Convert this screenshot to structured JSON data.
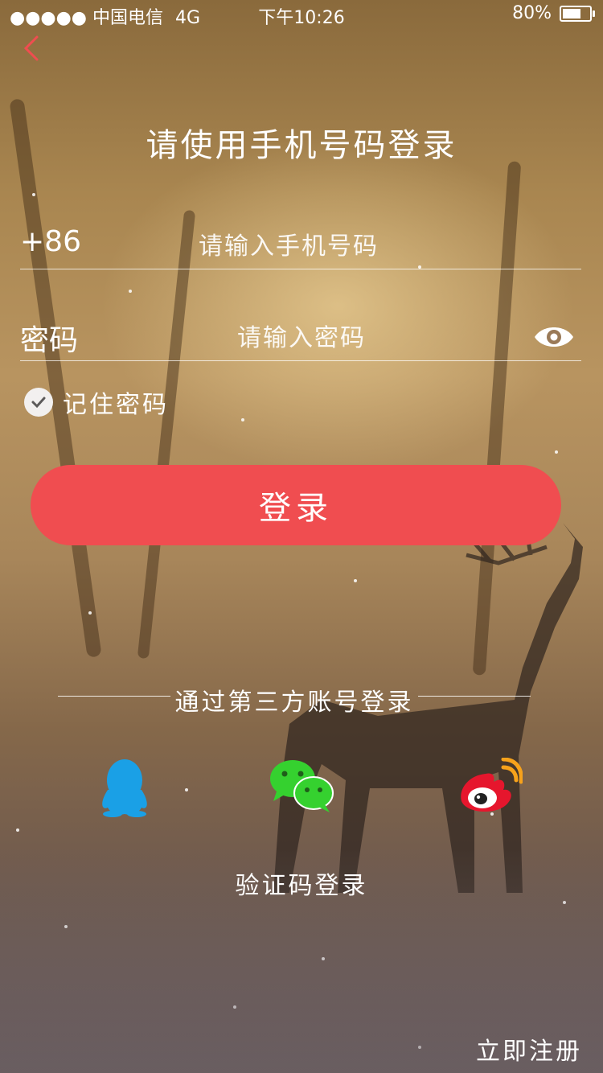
{
  "status_bar": {
    "signal_dots": "●●●●●",
    "carrier": "中国电信",
    "network": "4G",
    "time": "下午10:26",
    "battery": "80%",
    "battery_level": 0.8
  },
  "header": {
    "back_icon": "chevron-left-icon",
    "title": "请使用手机号码登录"
  },
  "phone": {
    "prefix": "+86",
    "placeholder": "请输入手机号码"
  },
  "password": {
    "label": "密码",
    "placeholder": "请输入密码",
    "toggle_icon": "eye-icon"
  },
  "remember": {
    "label": "记住密码",
    "checked": true
  },
  "login_button": {
    "label": "登录",
    "color": "#f04d50"
  },
  "third_party": {
    "title": "通过第三方账号登录",
    "providers": [
      {
        "name": "QQ",
        "icon": "qq-icon",
        "color": "#1aa0e6"
      },
      {
        "name": "WeChat",
        "icon": "wechat-icon",
        "color": "#35d12f"
      },
      {
        "name": "Weibo",
        "icon": "weibo-icon",
        "color": "#e6162d"
      }
    ]
  },
  "code_login": "验证码登录",
  "register": "立即注册",
  "accent": "#f04d50"
}
